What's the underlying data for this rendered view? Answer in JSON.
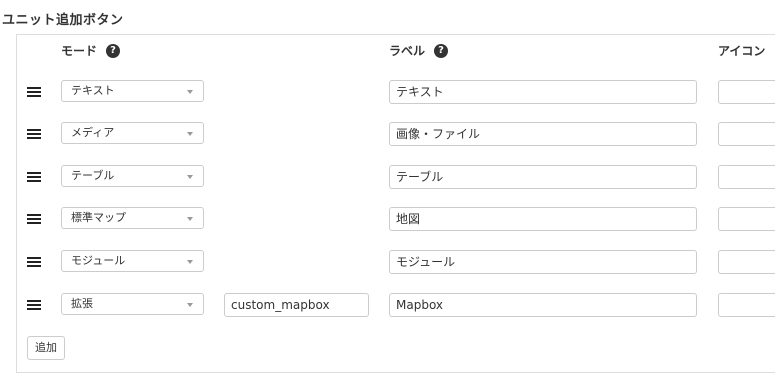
{
  "section_title": "ユニット追加ボタン",
  "columns": {
    "mode": "モード",
    "label": "ラベル",
    "icon": "アイコン",
    "help_glyph": "?"
  },
  "rows": [
    {
      "mode": "テキスト",
      "extra": "",
      "label": "テキスト",
      "icon": ""
    },
    {
      "mode": "メディア",
      "extra": "",
      "label": "画像・ファイル",
      "icon": ""
    },
    {
      "mode": "テーブル",
      "extra": "",
      "label": "テーブル",
      "icon": ""
    },
    {
      "mode": "標準マップ",
      "extra": "",
      "label": "地図",
      "icon": ""
    },
    {
      "mode": "モジュール",
      "extra": "",
      "label": "モジュール",
      "icon": ""
    },
    {
      "mode": "拡張",
      "extra": "custom_mapbox",
      "label": "Mapbox",
      "icon": ""
    }
  ],
  "add_button": "追加"
}
